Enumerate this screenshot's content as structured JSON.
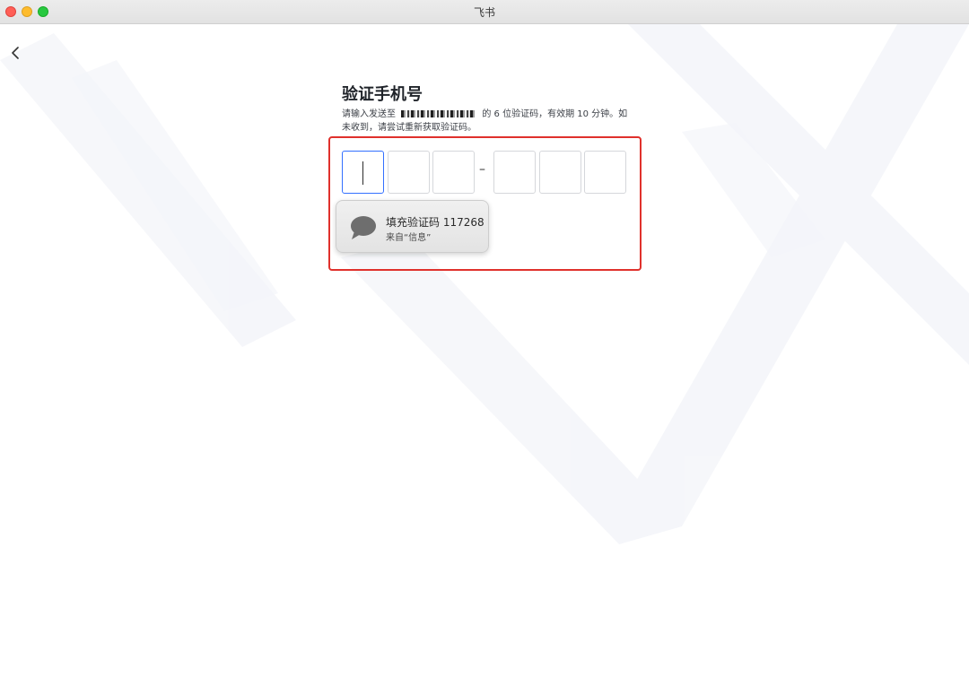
{
  "window": {
    "title": "飞书"
  },
  "page": {
    "title": "验证手机号",
    "desc_prefix": "请输入发送至",
    "desc_suffix": "的 6 位验证码，有效期 10 分钟。如未收到，请尝试重新获取验证码。"
  },
  "code": {
    "separator": "–",
    "digits": [
      "",
      "",
      "",
      "",
      "",
      ""
    ]
  },
  "autofill": {
    "text": "填充验证码 117268",
    "source": "来自“信息”"
  },
  "icons": {
    "back": "chevron-left-icon",
    "autofill": "message-bubble-icon"
  },
  "colors": {
    "accent": "#3370ff",
    "highlight": "#e0312c",
    "title_text": "#1f2329"
  }
}
